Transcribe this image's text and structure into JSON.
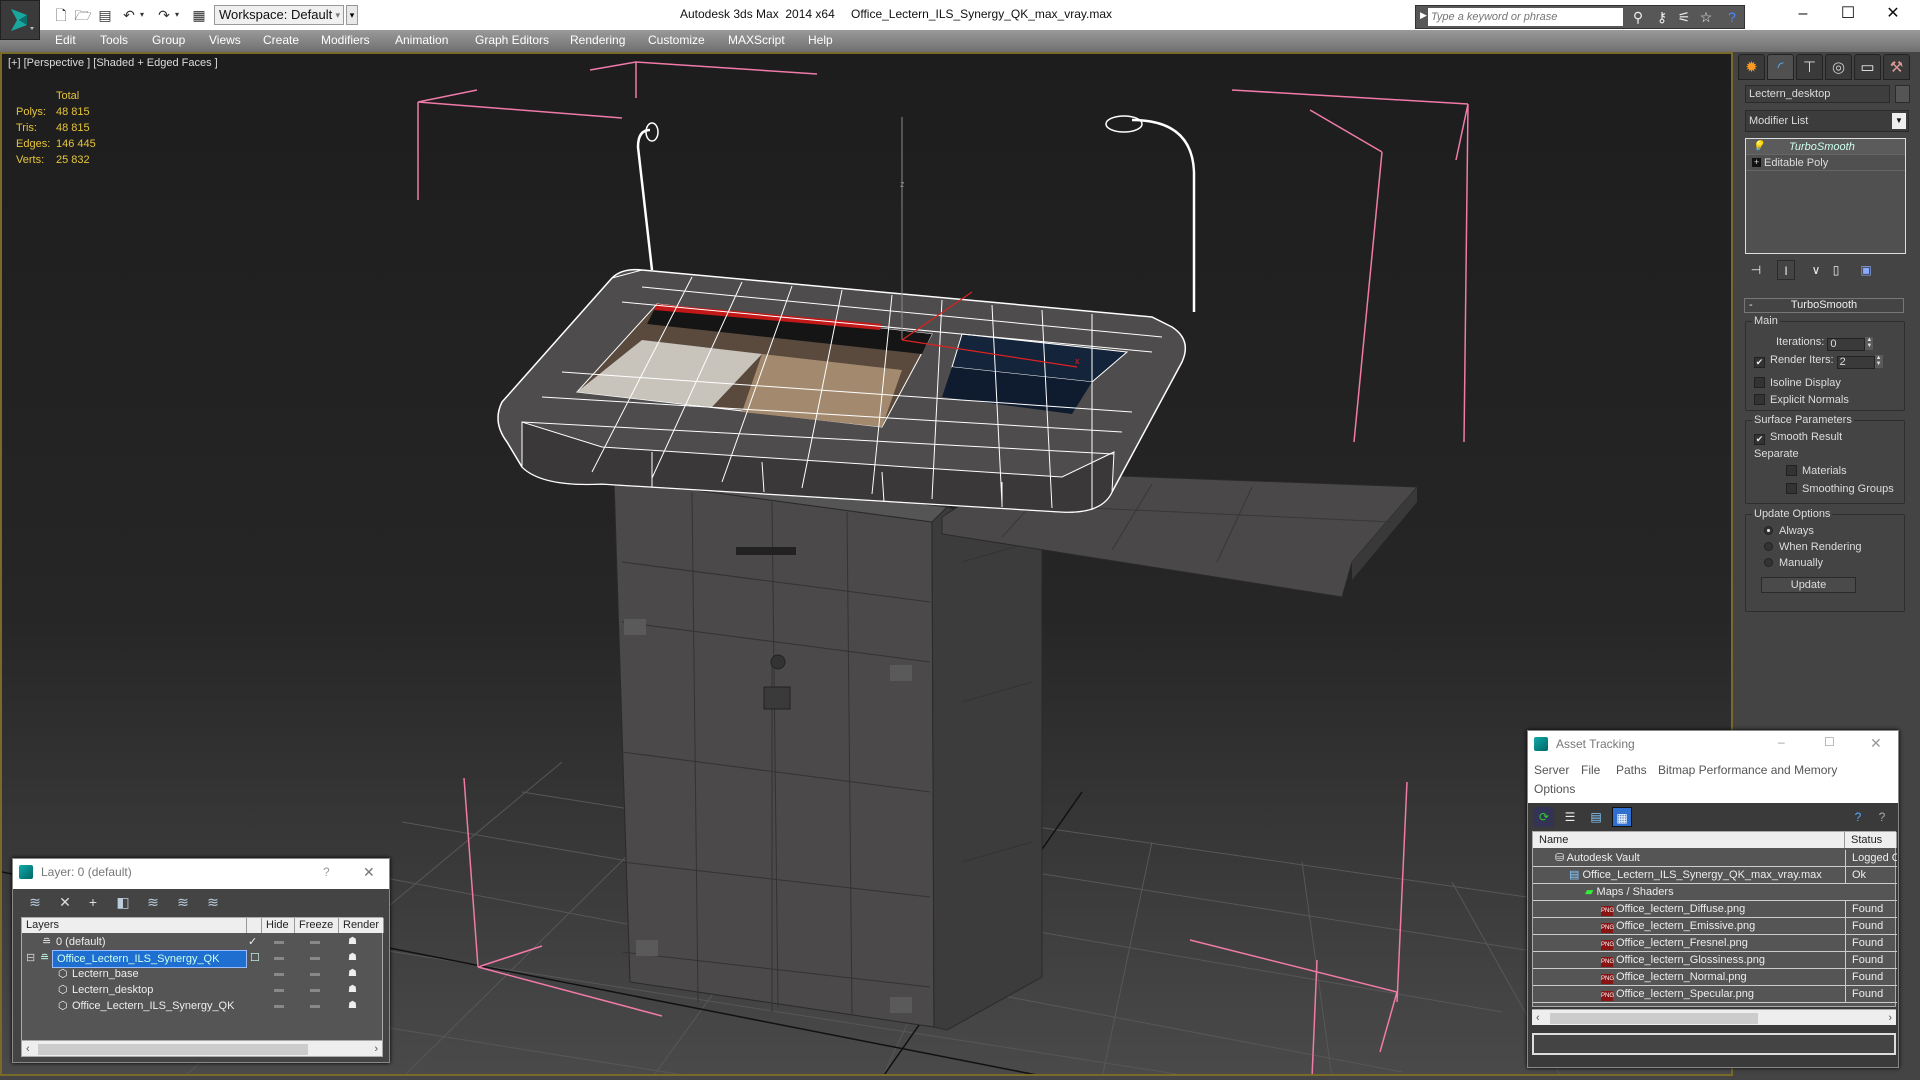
{
  "titlebar": {
    "workspace": "Workspace: Default",
    "app_title": "Autodesk 3ds Max  2014 x64",
    "file_title": "Office_Lectern_ILS_Synergy_QK_max_vray.max",
    "search_placeholder": "Type a keyword or phrase",
    "quick_access": [
      "new-file-icon",
      "open-file-icon",
      "save-icon",
      "undo-icon",
      "redo-icon",
      "project-folder-icon"
    ],
    "search_icons": [
      "binoculars-icon",
      "key-icon",
      "satellite-icon",
      "star-icon",
      "help-icon"
    ],
    "window_controls": {
      "minimize": "–",
      "maximize": "☐",
      "close": "✕"
    }
  },
  "menu": [
    "Edit",
    "Tools",
    "Group",
    "Views",
    "Create",
    "Modifiers",
    "Animation",
    "Graph Editors",
    "Rendering",
    "Customize",
    "MAXScript",
    "Help"
  ],
  "viewport": {
    "label": "[+] [Perspective ] [Shaded + Edged Faces ]",
    "stats": {
      "header": "Total",
      "rows": [
        {
          "label": "Polys:",
          "value": "48 815"
        },
        {
          "label": "Tris:",
          "value": "48 815"
        },
        {
          "label": "Edges:",
          "value": "146 445"
        },
        {
          "label": "Verts:",
          "value": "25 832"
        }
      ]
    },
    "axis_labels": {
      "z": "z",
      "x": "x"
    }
  },
  "command_panel": {
    "tabs": [
      "create-tab",
      "modify-tab",
      "hierarchy-tab",
      "motion-tab",
      "display-tab",
      "utilities-tab"
    ],
    "active_tab": 1,
    "object_name": "Lectern_desktop",
    "modifier_list": "Modifier List",
    "stack": [
      {
        "label": "TurboSmooth",
        "selected": true
      },
      {
        "label": "Editable Poly",
        "selected": false
      }
    ],
    "rollout": {
      "title": "TurboSmooth",
      "main": {
        "title": "Main",
        "iterations_label": "Iterations:",
        "iterations": "0",
        "render_iters_label": "Render Iters:",
        "render_iters": "2",
        "render_iters_checked": true,
        "isoline_display": "Isoline Display",
        "isoline_checked": false,
        "explicit_normals": "Explicit Normals",
        "explicit_checked": false
      },
      "surface": {
        "title": "Surface Parameters",
        "smooth_result": "Smooth Result",
        "smooth_checked": true,
        "separate": "Separate",
        "materials": "Materials",
        "materials_checked": false,
        "smoothing_groups": "Smoothing Groups",
        "smoothing_checked": false
      },
      "update": {
        "title": "Update Options",
        "options": [
          "Always",
          "When Rendering",
          "Manually"
        ],
        "selected": "Always",
        "button": "Update"
      }
    }
  },
  "layer_panel": {
    "title": "Layer: 0 (default)",
    "help": "?",
    "close": "✕",
    "columns": [
      "Layers",
      "",
      "Hide",
      "Freeze",
      "Render"
    ],
    "rows": [
      {
        "name": "0 (default)",
        "current": true,
        "selected": false,
        "indent": 1,
        "type": "layer"
      },
      {
        "name": "Office_Lectern_ILS_Synergy_QK",
        "current": false,
        "selected": true,
        "indent": 0,
        "type": "layer"
      },
      {
        "name": "Lectern_base",
        "selected": false,
        "indent": 2,
        "type": "object"
      },
      {
        "name": "Lectern_desktop",
        "selected": false,
        "indent": 2,
        "type": "object"
      },
      {
        "name": "Office_Lectern_ILS_Synergy_QK",
        "selected": false,
        "indent": 2,
        "type": "object"
      }
    ]
  },
  "asset_tracking": {
    "title": "Asset Tracking",
    "menu": [
      "Server",
      "File",
      "Paths",
      "Bitmap Performance and Memory",
      "Options"
    ],
    "columns": [
      "Name",
      "Status"
    ],
    "rows": [
      {
        "name": "Autodesk Vault",
        "status": "Logged O",
        "indent": 1,
        "icon": "vault-icon"
      },
      {
        "name": "Office_Lectern_ILS_Synergy_QK_max_vray.max",
        "status": "Ok",
        "indent": 2,
        "icon": "max-file-icon"
      },
      {
        "name": "Maps / Shaders",
        "status": "",
        "indent": 3,
        "icon": "maps-icon"
      },
      {
        "name": "Office_lectern_Diffuse.png",
        "status": "Found",
        "indent": 4,
        "icon": "png-icon"
      },
      {
        "name": "Office_lectern_Emissive.png",
        "status": "Found",
        "indent": 4,
        "icon": "png-icon"
      },
      {
        "name": "Office_lectern_Fresnel.png",
        "status": "Found",
        "indent": 4,
        "icon": "png-icon"
      },
      {
        "name": "Office_lectern_Glossiness.png",
        "status": "Found",
        "indent": 4,
        "icon": "png-icon"
      },
      {
        "name": "Office_lectern_Normal.png",
        "status": "Found",
        "indent": 4,
        "icon": "png-icon"
      },
      {
        "name": "Office_lectern_Specular.png",
        "status": "Found",
        "indent": 4,
        "icon": "png-icon"
      }
    ],
    "png_badge": "PNG"
  }
}
